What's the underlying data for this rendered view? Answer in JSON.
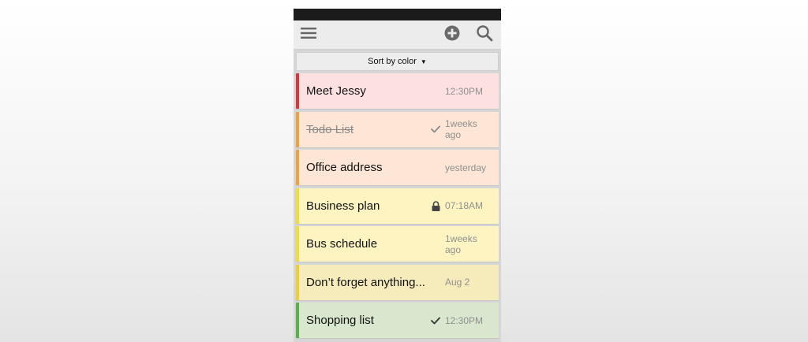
{
  "toolbar": {
    "menu_icon": "hamburger-menu-icon",
    "add_icon": "plus-circle-icon",
    "search_icon": "search-icon"
  },
  "sort": {
    "label": "Sort by color",
    "arrow": "▼"
  },
  "notes": [
    {
      "title": "Meet Jessy",
      "time": "12:30PM",
      "color": "#fde1e1",
      "accent": "#d9363e",
      "marker": ""
    },
    {
      "title": "Todo List",
      "time": "1weeks ago",
      "color": "#fde6d6",
      "accent": "#f0a23a",
      "marker": "checkmark-icon",
      "done": true
    },
    {
      "title": "Office address",
      "time": "yesterday",
      "color": "#fde6d6",
      "accent": "#f0a23a",
      "marker": ""
    },
    {
      "title": "Business plan",
      "time": "07:18AM",
      "color": "#fdf4c2",
      "accent": "#f2dd33",
      "marker": "lock-icon"
    },
    {
      "title": "Bus schedule",
      "time": "1weeks ago",
      "color": "#fdf4c2",
      "accent": "#f2dd33",
      "marker": ""
    },
    {
      "title": "Don’t forget anything...",
      "time": "Aug 2",
      "color": "#f6ecbb",
      "accent": "#ecd12c",
      "marker": ""
    },
    {
      "title": "Shopping list",
      "time": "12:30PM",
      "color": "#d9e7cf",
      "accent": "#55b24b",
      "marker": "checkmark-icon"
    }
  ]
}
